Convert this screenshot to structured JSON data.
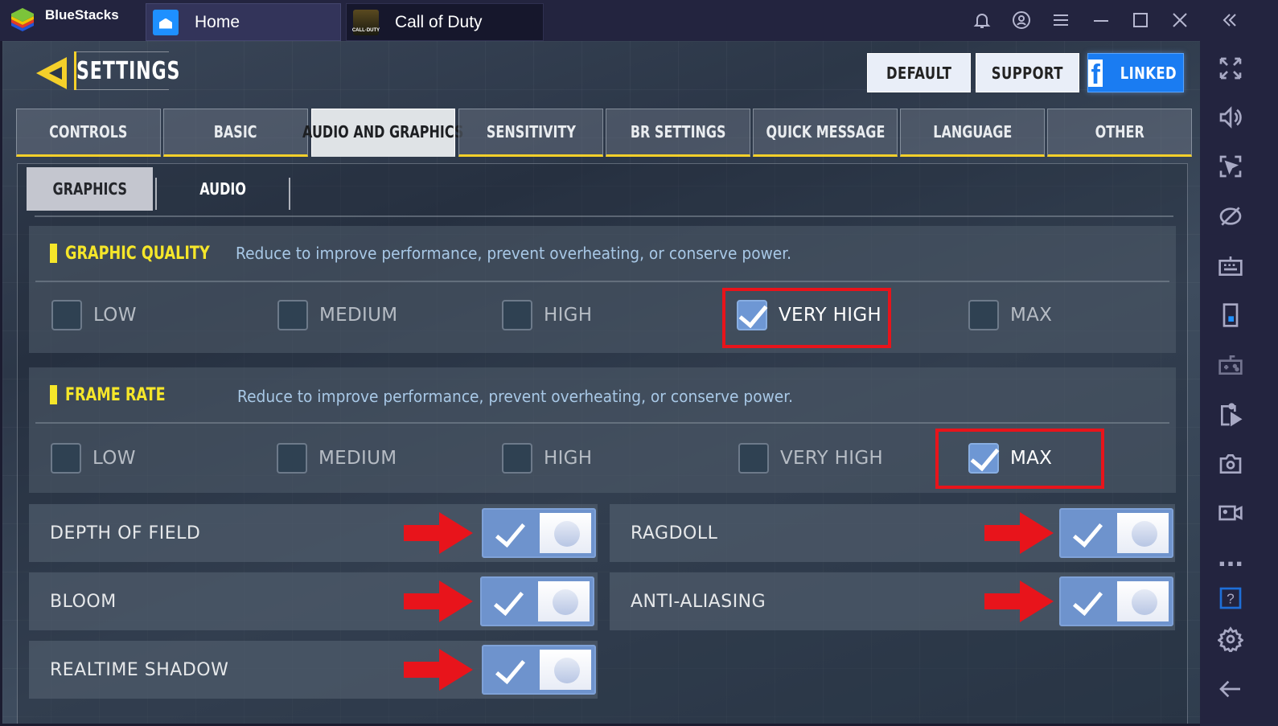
{
  "titlebar": {
    "app_name": "BlueStacks",
    "tabs": [
      {
        "label": "Home",
        "icon": "home-icon"
      },
      {
        "label": "Call of Duty",
        "icon": "call-of-duty-icon",
        "icon_text": "CALL·DUTY"
      }
    ],
    "controls": [
      "bell-icon",
      "account-icon",
      "menu-icon",
      "minimize-icon",
      "maximize-icon",
      "close-icon",
      "collapse-sidebar-icon"
    ]
  },
  "right_sidebar": {
    "icons": [
      "fullscreen-icon",
      "volume-icon",
      "lock-cursor-icon",
      "eye-off-icon",
      "keyboard-icon",
      "rotate-icon",
      "gamepad-icon",
      "apk-install-icon",
      "screenshot-icon",
      "record-video-icon",
      "more-icon",
      "help-icon",
      "settings-icon",
      "back-icon"
    ]
  },
  "game": {
    "title": "SETTINGS",
    "top_buttons": {
      "default": "DEFAULT",
      "support": "SUPPORT",
      "linked": "LINKED",
      "linked_icon": "f"
    },
    "main_tabs": [
      {
        "label": "CONTROLS",
        "active": false
      },
      {
        "label": "BASIC",
        "active": false
      },
      {
        "label": "AUDIO AND GRAPHICS",
        "active": true
      },
      {
        "label": "SENSITIVITY",
        "active": false
      },
      {
        "label": "BR SETTINGS",
        "active": false
      },
      {
        "label": "QUICK MESSAGE",
        "active": false
      },
      {
        "label": "LANGUAGE",
        "active": false
      },
      {
        "label": "OTHER",
        "active": false
      }
    ],
    "sub_tabs": [
      {
        "label": "GRAPHICS",
        "active": true
      },
      {
        "label": "AUDIO",
        "active": false
      }
    ],
    "graphic_quality": {
      "title": "GRAPHIC QUALITY",
      "description": "Reduce to improve performance, prevent overheating, or conserve power.",
      "options": [
        "LOW",
        "MEDIUM",
        "HIGH",
        "VERY HIGH",
        "MAX"
      ],
      "selected": "VERY HIGH"
    },
    "frame_rate": {
      "title": "FRAME RATE",
      "description": "Reduce to improve performance, prevent overheating, or conserve power.",
      "options": [
        "LOW",
        "MEDIUM",
        "HIGH",
        "VERY HIGH",
        "MAX"
      ],
      "selected": "MAX"
    },
    "toggles": [
      {
        "label": "DEPTH OF FIELD",
        "enabled": true
      },
      {
        "label": "RAGDOLL",
        "enabled": true
      },
      {
        "label": "BLOOM",
        "enabled": true
      },
      {
        "label": "ANTI-ALIASING",
        "enabled": true
      },
      {
        "label": "REALTIME SHADOW",
        "enabled": true
      }
    ]
  },
  "colors": {
    "accent_yellow": "#f5e62a",
    "highlight_red": "#e8141b",
    "checkbox_blue": "#6e97d4",
    "facebook_blue": "#1a7cf2"
  }
}
